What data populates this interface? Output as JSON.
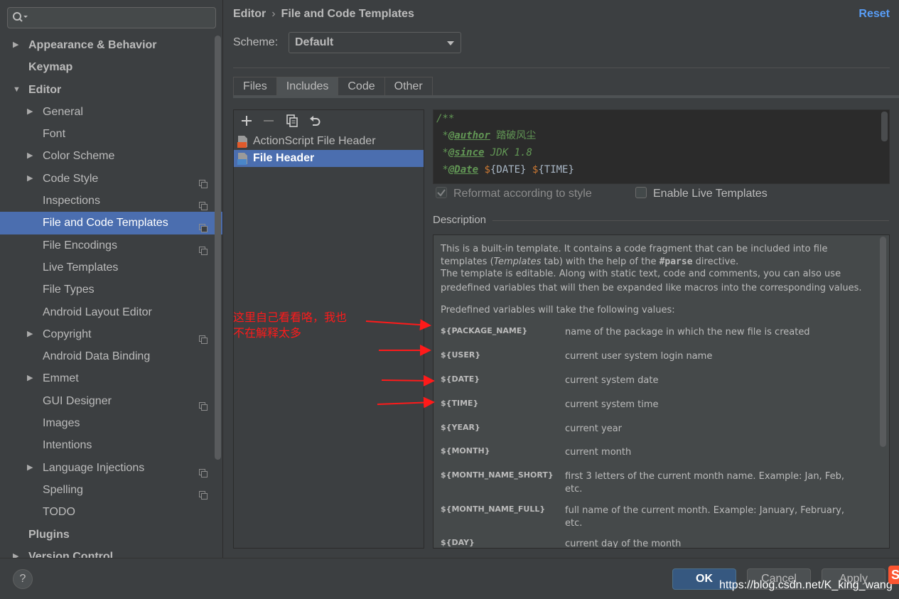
{
  "search": {
    "value": ""
  },
  "tree": [
    {
      "label": "Appearance & Behavior",
      "level": 0,
      "arrow": "right"
    },
    {
      "label": "Keymap",
      "level": 0
    },
    {
      "label": "Editor",
      "level": 0,
      "arrow": "down"
    },
    {
      "label": "General",
      "level": 1,
      "arrow": "right"
    },
    {
      "label": "Font",
      "level": 1
    },
    {
      "label": "Color Scheme",
      "level": 1,
      "arrow": "right"
    },
    {
      "label": "Code Style",
      "level": 1,
      "arrow": "right",
      "copy": true
    },
    {
      "label": "Inspections",
      "level": 1,
      "copy": true
    },
    {
      "label": "File and Code Templates",
      "level": 1,
      "copy": true,
      "selected": true
    },
    {
      "label": "File Encodings",
      "level": 1,
      "copy": true
    },
    {
      "label": "Live Templates",
      "level": 1
    },
    {
      "label": "File Types",
      "level": 1
    },
    {
      "label": "Android Layout Editor",
      "level": 1
    },
    {
      "label": "Copyright",
      "level": 1,
      "arrow": "right",
      "copy": true
    },
    {
      "label": "Android Data Binding",
      "level": 1
    },
    {
      "label": "Emmet",
      "level": 1,
      "arrow": "right"
    },
    {
      "label": "GUI Designer",
      "level": 1,
      "copy": true
    },
    {
      "label": "Images",
      "level": 1
    },
    {
      "label": "Intentions",
      "level": 1
    },
    {
      "label": "Language Injections",
      "level": 1,
      "arrow": "right",
      "copy": true
    },
    {
      "label": "Spelling",
      "level": 1,
      "copy": true
    },
    {
      "label": "TODO",
      "level": 1
    },
    {
      "label": "Plugins",
      "level": 0
    },
    {
      "label": "Version Control",
      "level": 0,
      "arrow": "right",
      "copy": true
    }
  ],
  "header": {
    "crumb_parent": "Editor",
    "crumb_sep": "›",
    "crumb_current": "File and Code Templates",
    "reset": "Reset"
  },
  "scheme": {
    "label": "Scheme:",
    "value": "Default"
  },
  "tabs": [
    {
      "label": "Files"
    },
    {
      "label": "Includes",
      "active": true
    },
    {
      "label": "Code"
    },
    {
      "label": "Other"
    }
  ],
  "toolbar": {
    "add": "add-icon",
    "remove": "remove-icon",
    "copy": "copy-icon",
    "reset": "undo-icon"
  },
  "templates": [
    {
      "label": "ActionScript File Header",
      "icon": "AS"
    },
    {
      "label": "File Header",
      "icon": "J",
      "selected": true
    }
  ],
  "editor": {
    "l1": "/**",
    "l2_star": " *",
    "l2_tag": "@author",
    "l2_text": " 踏破风尘",
    "l3_star": " *",
    "l3_tag": "@since",
    "l3_text": " JDK 1.8",
    "l4_star": " *",
    "l4_tag": "@Date",
    "l4_d1": "$",
    "l4_v1": "{DATE}",
    "l4_d2": "$",
    "l4_v2": "{TIME}"
  },
  "options": {
    "reformat_label": "Reformat according to style",
    "reformat_checked": true,
    "live_label": "Enable Live Templates",
    "live_checked": false
  },
  "description": {
    "label": "Description",
    "intro1": "This is a built-in template. It contains a code fragment that can be included into file",
    "intro2_a": "templates (",
    "intro2_b": "Templates",
    "intro2_c": " tab) with the help of the ",
    "intro2_d": "#parse",
    "intro2_e": " directive.",
    "intro3": "The template is editable. Along with static text, code and comments, you can also use",
    "intro4": "predefined variables that will then be expanded like macros into the corresponding values.",
    "predef": "Predefined variables will take the following values:",
    "vars": [
      {
        "name": "${PACKAGE_NAME}",
        "desc": "name of the package in which the new file is created"
      },
      {
        "name": "${USER}",
        "desc": "current user system login name"
      },
      {
        "name": "${DATE}",
        "desc": "current system date"
      },
      {
        "name": "${TIME}",
        "desc": "current system time"
      },
      {
        "name": "${YEAR}",
        "desc": "current year"
      },
      {
        "name": "${MONTH}",
        "desc": "current month"
      },
      {
        "name": "${MONTH_NAME_SHORT}",
        "desc": "first 3 letters of the current month name. Example: Jan, Feb, etc."
      },
      {
        "name": "${MONTH_NAME_FULL}",
        "desc": "full name of the current month. Example: January, February, etc."
      },
      {
        "name": "${DAY}",
        "desc": "current day of the month"
      }
    ]
  },
  "annotation": {
    "line1": "这里自己看看咯，我也",
    "line2": "不在解释太多",
    "color": "#ff1a1a"
  },
  "footer": {
    "help": "?",
    "ok": "OK",
    "cancel": "Cancel",
    "apply": "Apply",
    "watermark": "https://blog.csdn.net/K_king_wang",
    "logo": "S"
  },
  "colors": {
    "selection": "#4b6eaf",
    "link": "#589df6",
    "bg": "#3c3f41"
  }
}
